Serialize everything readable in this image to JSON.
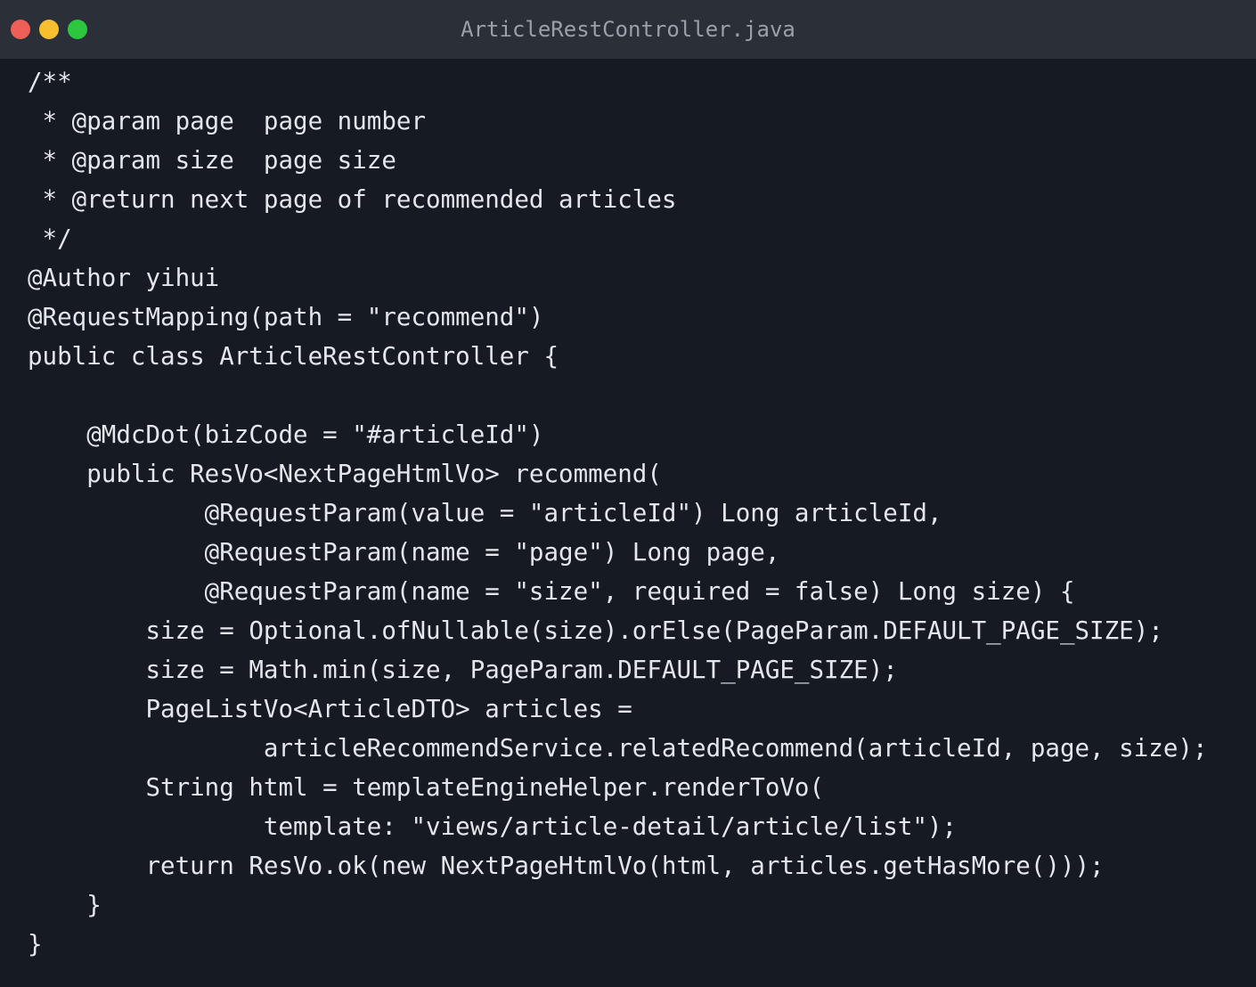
{
  "window": {
    "title": "ArticleRestController.java",
    "controls": {
      "close_color": "#ee5f57",
      "minimize_color": "#f7be2d",
      "maximize_color": "#2cc63f"
    }
  },
  "code": {
    "lines": [
      "/**",
      " * @param page  page number",
      " * @param size  page size",
      " * @return next page of recommended articles",
      " */",
      "@Author yihui",
      "@RequestMapping(path = \"recommend\")",
      "public class ArticleRestController {",
      "",
      "    @MdcDot(bizCode = \"#articleId\")",
      "    public ResVo<NextPageHtmlVo> recommend(",
      "            @RequestParam(value = \"articleId\") Long articleId,",
      "            @RequestParam(name = \"page\") Long page,",
      "            @RequestParam(name = \"size\", required = false) Long size) {",
      "        size = Optional.ofNullable(size).orElse(PageParam.DEFAULT_PAGE_SIZE);",
      "        size = Math.min(size, PageParam.DEFAULT_PAGE_SIZE);",
      "        PageListVo<ArticleDTO> articles =",
      "                articleRecommendService.relatedRecommend(articleId, page, size);",
      "        String html = templateEngineHelper.renderToVo(",
      "                template: \"views/article-detail/article/list\");",
      "        return ResVo.ok(new NextPageHtmlVo(html, articles.getHasMore()));",
      "    }",
      "}"
    ]
  }
}
